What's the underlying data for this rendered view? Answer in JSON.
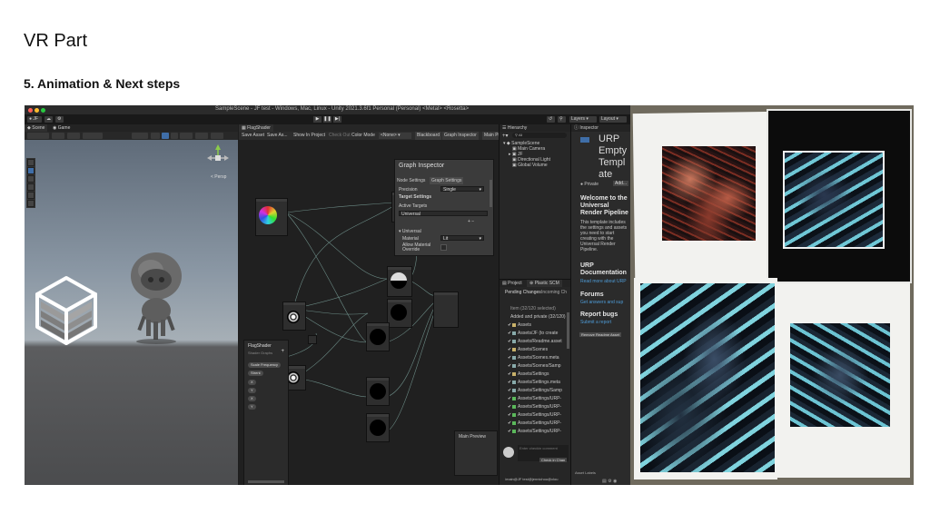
{
  "slide": {
    "title": "VR Part",
    "subtitle": "5. Animation & Next steps"
  },
  "unity": {
    "window_title": "SampleScene - JF test - Windows, Mac, Linux - Unity 2021.3.6f1 Personal (Personal) <Metal> <Rosetta>",
    "toolbar": {
      "account": "JF",
      "layers": "Layers",
      "layout": "Layout"
    },
    "scene": {
      "tab_scene": "Scene",
      "tab_game": "Game",
      "persp_label": "< Persp"
    },
    "shader_graph": {
      "tab": "FlagShader",
      "toolbar": [
        "Save Asset",
        "Save As...",
        "Show In Project",
        "Check Out",
        "Color Mode",
        "<None>",
        "Blackboard",
        "Graph Inspector",
        "Main Pr"
      ],
      "graph_inspector": {
        "title": "Graph Inspector",
        "tab_node": "Node Settings",
        "tab_graph": "Graph Settings",
        "precision_label": "Precision",
        "precision_value": "Single",
        "target_settings": "Target Settings",
        "active_targets": "Active Targets",
        "universal": "Universal",
        "section_universal": "Universal",
        "material_label": "Material",
        "material_value": "Lit",
        "allow_override": "Allow Material Override"
      },
      "blackboard": {
        "title": "FlagShader",
        "subtitle": "Shader Graphs",
        "pills": [
          "Scale Frequency",
          "Strent",
          "X",
          "Y",
          "X",
          "Y"
        ]
      },
      "main_preview": "Main Preview"
    },
    "hierarchy": {
      "title": "Hierarchy",
      "search": "All",
      "items": [
        "SampleScene",
        "Main Camera",
        "JF",
        "Directional Light",
        "Global Volume"
      ]
    },
    "project": {
      "tabs": [
        "Project",
        "Plastic SCM"
      ],
      "subtabs": [
        "Pending Changes",
        "Incoming Ch"
      ],
      "items": [
        "Item (32/120 selected)",
        "Added and private (32/120)",
        "Assets",
        "Assets/JF (to create",
        "Assets/Readme.asset",
        "Assets/Scenes",
        "Assets/Scenes.meta",
        "Assets/Scenes/Samp",
        "Assets/Settings",
        "Assets/Settings.meta",
        "Assets/Settings/Samp",
        "Assets/Settings/URP-",
        "Assets/Settings/URP-",
        "Assets/Settings/URP-",
        "Assets/Settings/URP-",
        "Assets/Settings/URP-"
      ],
      "checkin_placeholder": "Enter checkin comment",
      "checkin_button": "Check in Chan",
      "footer": "/main@JF test@jennichou@clou"
    },
    "inspector": {
      "title": "Inspector",
      "heading": [
        "URP",
        "Empty",
        "Templ",
        "ate"
      ],
      "private": "Private",
      "add": "Add...",
      "welcome_title": "Welcome to the Universal Render Pipeline",
      "welcome_body": "This template includes the settings and assets you need to start creating with the Universal Render Pipeline.",
      "doc_title": "URP Documentation",
      "doc_link": "Read more about URP",
      "forums_title": "Forums",
      "forums_link": "Get answers and sup",
      "bugs_title": "Report bugs",
      "bugs_link": "Submit a report",
      "remove_button": "Remove Readme Asset",
      "asset_labels": "Asset Labels"
    }
  }
}
